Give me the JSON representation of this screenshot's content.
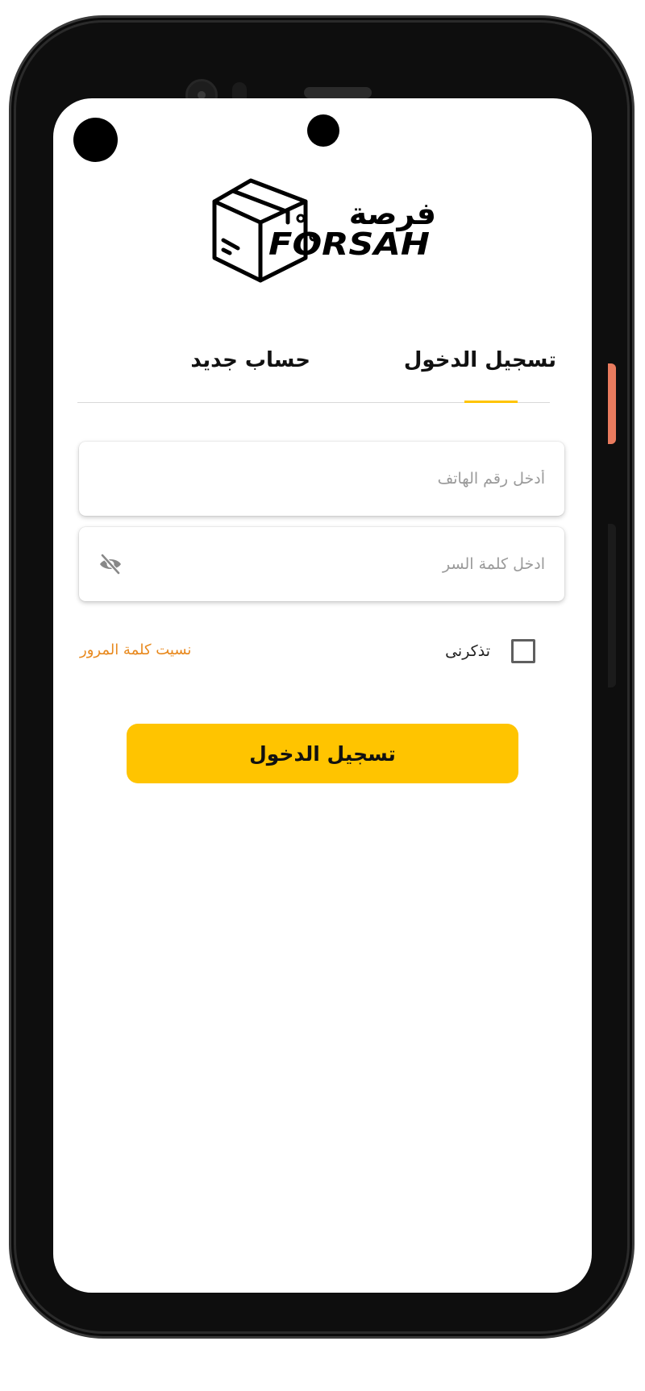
{
  "logo": {
    "arabic_text": "فرصة",
    "latin_text": "FORSAH"
  },
  "tabs": {
    "login_label": "تسجيل الدخول",
    "register_label": "حساب جديد",
    "active": "login",
    "indicator_color": "#ffc400"
  },
  "phone_field": {
    "value": "",
    "placeholder": "أدخل رقم الهاتف"
  },
  "password_field": {
    "value": "",
    "placeholder": "ادخل كلمة السر",
    "toggle_icon": "eye-off-icon"
  },
  "remember_me": {
    "label": "تذكرنى",
    "checked": false
  },
  "forgot_password": {
    "label": "نسيت كلمة المرور",
    "color": "#e8891e"
  },
  "login_button": {
    "label": "تسجيل الدخول",
    "color": "#ffc400"
  }
}
